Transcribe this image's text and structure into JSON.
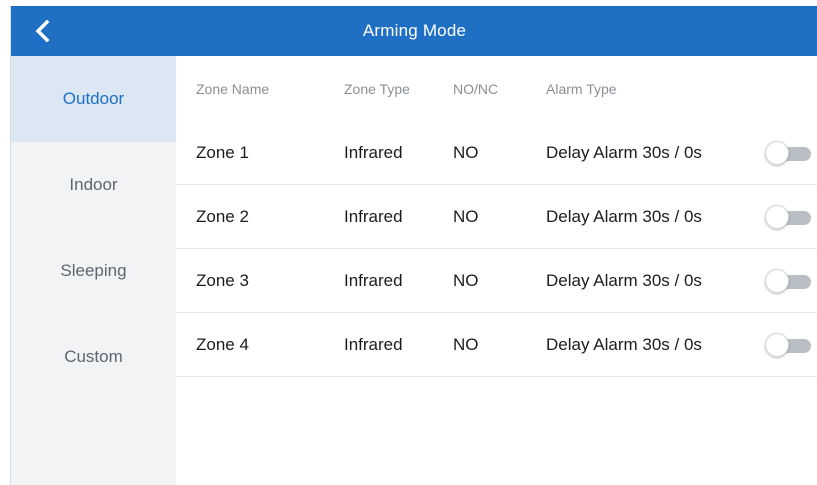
{
  "header": {
    "title": "Arming Mode",
    "back_icon": "chevron-left-icon"
  },
  "sidebar": {
    "items": [
      {
        "label": "Outdoor",
        "active": true
      },
      {
        "label": "Indoor",
        "active": false
      },
      {
        "label": "Sleeping",
        "active": false
      },
      {
        "label": "Custom",
        "active": false
      }
    ]
  },
  "table": {
    "columns": [
      "Zone Name",
      "Zone Type",
      "NO/NC",
      "Alarm Type"
    ],
    "rows": [
      {
        "zone_name": "Zone 1",
        "zone_type": "Infrared",
        "no_nc": "NO",
        "alarm_type": "Delay Alarm 30s / 0s",
        "enabled": false
      },
      {
        "zone_name": "Zone 2",
        "zone_type": "Infrared",
        "no_nc": "NO",
        "alarm_type": "Delay Alarm 30s / 0s",
        "enabled": false
      },
      {
        "zone_name": "Zone 3",
        "zone_type": "Infrared",
        "no_nc": "NO",
        "alarm_type": "Delay Alarm 30s / 0s",
        "enabled": false
      },
      {
        "zone_name": "Zone 4",
        "zone_type": "Infrared",
        "no_nc": "NO",
        "alarm_type": "Delay Alarm 30s / 0s",
        "enabled": false
      }
    ]
  },
  "colors": {
    "header_bg": "#1f6fc5",
    "active_tab_bg": "#dbe8f4",
    "active_tab_text": "#1f6fc5",
    "toggle_off_track": "#b9bec4"
  }
}
